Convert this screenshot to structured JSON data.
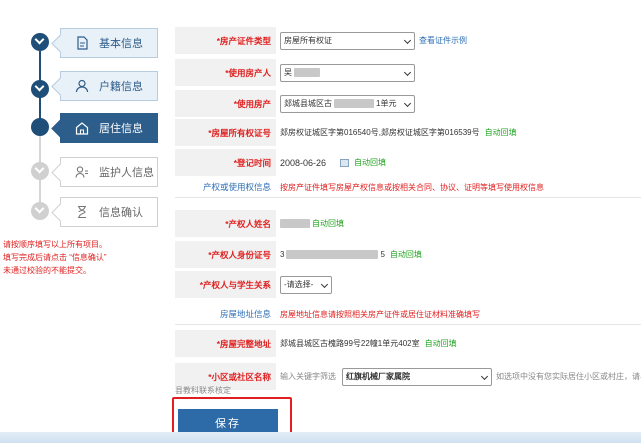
{
  "steps": [
    {
      "label": "基本信息",
      "icon": "document-icon",
      "state": "done"
    },
    {
      "label": "户籍信息",
      "icon": "user-icon",
      "state": "done"
    },
    {
      "label": "居住信息",
      "icon": "home-icon",
      "state": "active"
    },
    {
      "label": "监护人信息",
      "icon": "guardian-icon",
      "state": "pending"
    },
    {
      "label": "信息确认",
      "icon": "hourglass-icon",
      "state": "pending"
    }
  ],
  "sidebar_note": {
    "line1": "请按顺序填写以上所有项目。",
    "line2": "填写完成后请点击 “信息确认”",
    "line3": "未通过校验的不能提交。"
  },
  "form": {
    "cert_type": {
      "label": "*房产证件类型",
      "value": "房屋所有权证",
      "link": "查看证件示例"
    },
    "user": {
      "label": "*使用房产人",
      "value": "吴"
    },
    "property": {
      "label": "*使用房产",
      "value_prefix": "郯城县城区古",
      "value_suffix": "1单元"
    },
    "cert_no": {
      "label": "*房屋所有权证号",
      "value": "郯房权证城区字第016540号,郯房权证城区字第016539号",
      "auto": "自动回填"
    },
    "reg_time": {
      "label": "*登记时间",
      "value": "2008-06-26",
      "auto": "自动回填"
    },
    "section_owner": {
      "label": "产权或使用权信息",
      "text": "按房产证件填写房屋产权信息或按相关合同、协议、证明等填写使用权信息"
    },
    "owner_name": {
      "label": "*产权人姓名",
      "auto": "自动回填"
    },
    "owner_id": {
      "label": "*产权人身份证号",
      "prefix": "3",
      "suffix": "5",
      "auto": "自动回填"
    },
    "relation": {
      "label": "*产权人与学生关系",
      "value": "-请选择-"
    },
    "section_addr": {
      "label": "房屋地址信息",
      "text": "房屋地址信息请按照相关房产证件或居住证材料准确填写"
    },
    "full_addr": {
      "label": "*房屋完整地址",
      "value": "郯城县城区古槐路99号22幢1单元402室",
      "auto": "自动回填"
    },
    "community": {
      "label": "*小区或社区名称",
      "placeholder": "输入关键字筛选",
      "value": "红旗机械厂家属院",
      "hint": "如选项中没有您实际居住小区或村庄，请与",
      "hint2": "县教科联系核定"
    }
  },
  "save_label": "保存"
}
